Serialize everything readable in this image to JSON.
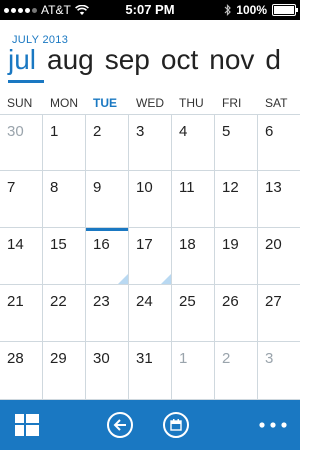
{
  "status_bar": {
    "carrier": "AT&T",
    "time": "5:07 PM",
    "battery": "100%",
    "signal_bars": 4,
    "battery_level": 1.0,
    "icons": [
      "signal-dots-icon",
      "wifi-icon",
      "bluetooth-icon",
      "battery-icon"
    ]
  },
  "header": {
    "month_year": "JULY 2013",
    "months": [
      "jul",
      "aug",
      "sep",
      "oct",
      "nov",
      "d"
    ],
    "active_month_index": 0
  },
  "weekdays": [
    "SUN",
    "MON",
    "TUE",
    "WED",
    "THU",
    "FRI",
    "SAT"
  ],
  "today_weekday_index": 2,
  "calendar": {
    "weeks": [
      [
        "30",
        "1",
        "2",
        "3",
        "4",
        "5",
        "6"
      ],
      [
        "7",
        "8",
        "9",
        "10",
        "11",
        "12",
        "13"
      ],
      [
        "14",
        "15",
        "16",
        "17",
        "18",
        "19",
        "20"
      ],
      [
        "21",
        "22",
        "23",
        "24",
        "25",
        "26",
        "27"
      ],
      [
        "28",
        "29",
        "30",
        "31",
        "1",
        "2",
        "3"
      ]
    ],
    "other_month_cells": [
      [
        0,
        0
      ],
      [
        4,
        4
      ],
      [
        4,
        5
      ],
      [
        4,
        6
      ]
    ],
    "today_cell": [
      2,
      2
    ],
    "event_marker_cells": [
      [
        2,
        2
      ],
      [
        2,
        3
      ]
    ]
  },
  "app_bar": {
    "icons": [
      "view-switch-icon",
      "back-icon",
      "today-icon",
      "more-icon"
    ]
  },
  "colors": {
    "accent": "#1a78c2",
    "grid_line": "#cfd8de",
    "muted_day": "#9aa4ac",
    "event_marker": "#b9d9f2"
  }
}
